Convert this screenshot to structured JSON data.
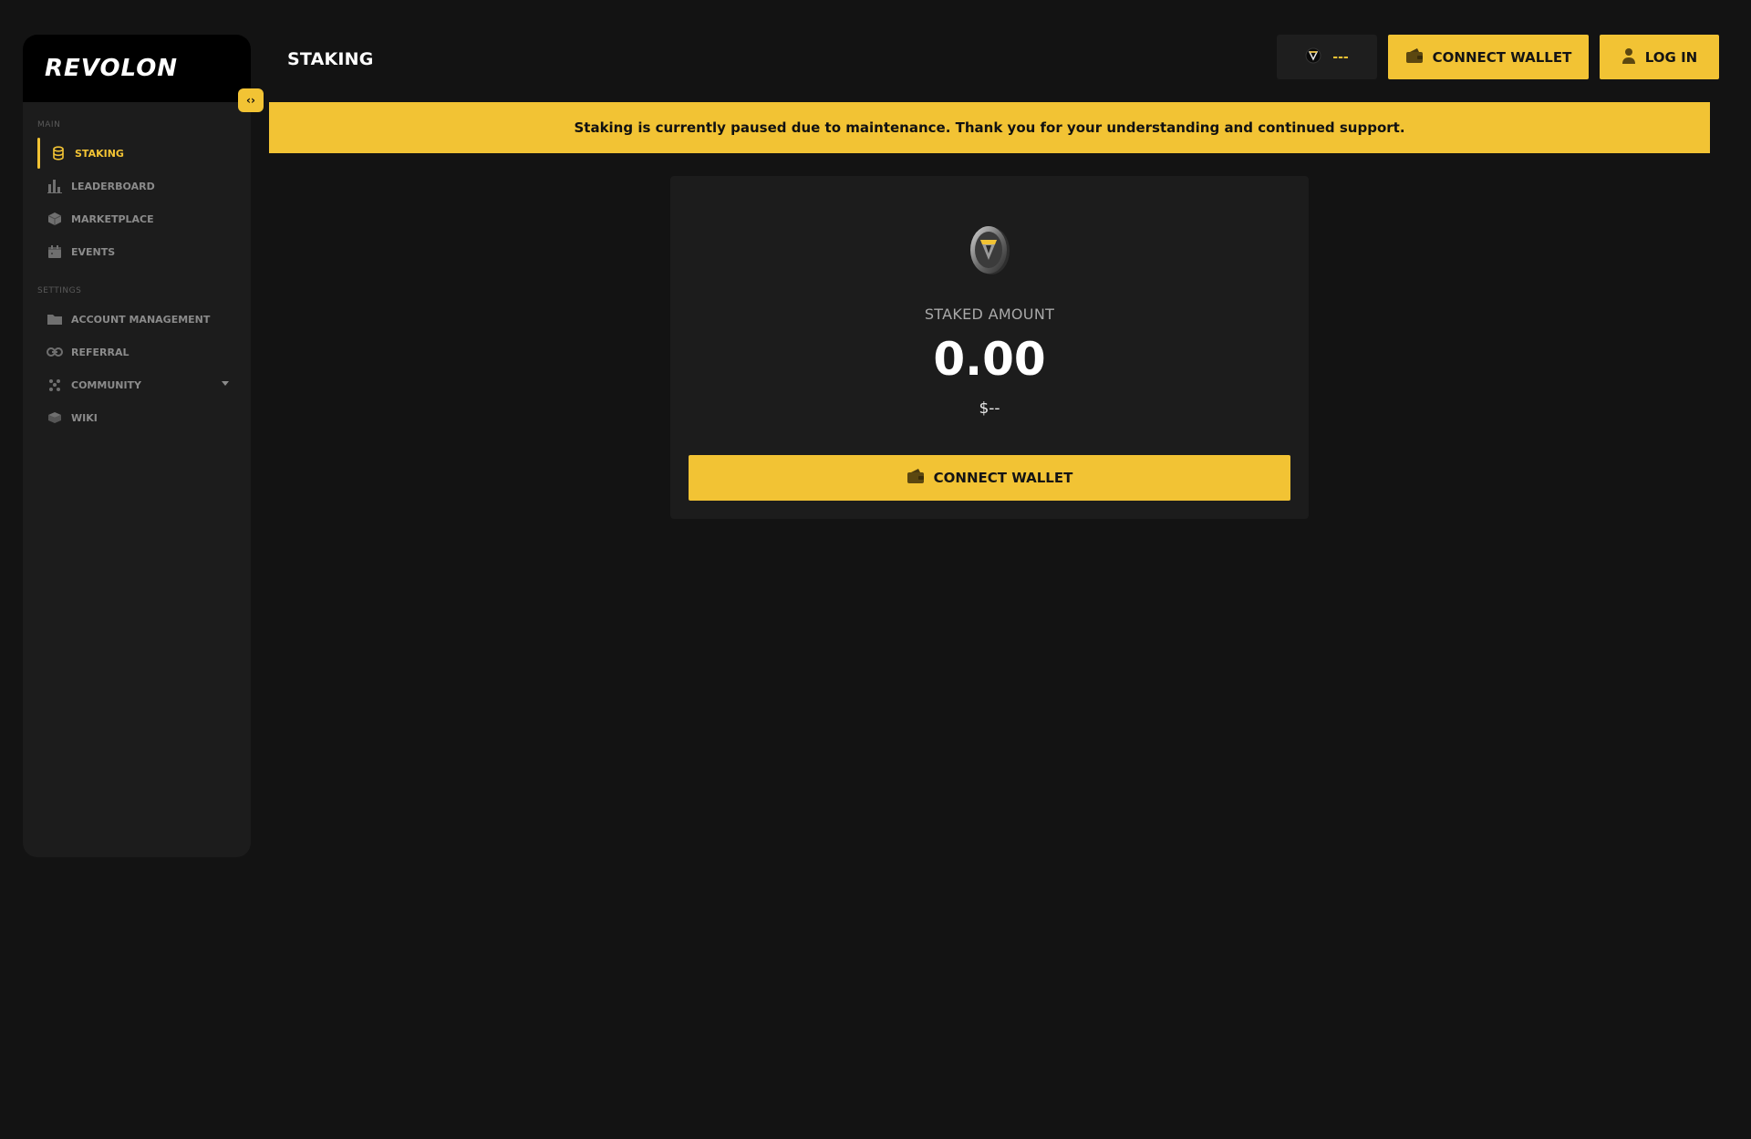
{
  "brand": {
    "logo_text": "REVOLON"
  },
  "sidebar": {
    "sections": [
      {
        "label": "MAIN",
        "items": [
          {
            "label": "STAKING",
            "icon": "coins-icon",
            "active": true
          },
          {
            "label": "LEADERBOARD",
            "icon": "bar-chart-icon"
          },
          {
            "label": "MARKETPLACE",
            "icon": "cube-icon"
          },
          {
            "label": "EVENTS",
            "icon": "calendar-icon"
          }
        ]
      },
      {
        "label": "SETTINGS",
        "items": [
          {
            "label": "ACCOUNT MANAGEMENT",
            "icon": "folder-icon"
          },
          {
            "label": "REFERRAL",
            "icon": "link-icon"
          },
          {
            "label": "COMMUNITY",
            "icon": "community-icon",
            "has_dropdown": true
          },
          {
            "label": "WIKI",
            "icon": "book-icon"
          }
        ]
      }
    ],
    "toggle_glyph": "‹›"
  },
  "header": {
    "title": "STAKING",
    "balance_value": "---",
    "connect_wallet_label": "CONNECT WALLET",
    "login_label": "LOG IN"
  },
  "notice": {
    "text": "Staking is currently paused due to maintenance. Thank you for your understanding and continued support."
  },
  "stake_card": {
    "label": "STAKED AMOUNT",
    "amount": "0.00",
    "usd_value": "$--",
    "connect_wallet_label": "CONNECT WALLET"
  },
  "colors": {
    "accent": "#f2c334",
    "background": "#131313",
    "panel": "#1c1c1c",
    "muted_text": "#8b8b8b"
  }
}
